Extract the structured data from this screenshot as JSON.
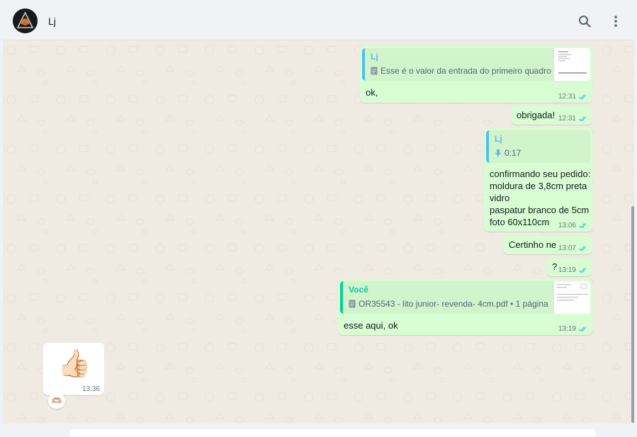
{
  "header": {
    "contact_name": "Lj",
    "search_icon": "search-icon",
    "menu_icon": "kebab-menu-icon"
  },
  "messages": [
    {
      "direction": "out",
      "quote": {
        "author": "Lj",
        "text": "Esse é o valor da entrada do primeiro quadro",
        "icon": "document-icon",
        "thumb": "document-thumbnail"
      },
      "text": "ok,",
      "time": "12:31",
      "status": "read"
    },
    {
      "direction": "out",
      "text": "obrigada!",
      "time": "12:31",
      "status": "read"
    },
    {
      "direction": "out",
      "quote": {
        "author": "Lj",
        "text": "0:17",
        "icon": "microphone-icon"
      },
      "text": "confirmando seu pedido:\nmoldura de 3,8cm preta\nvidro\npaspatur branco de 5cm\nfoto 60x110cm",
      "time": "13:06",
      "status": "read"
    },
    {
      "direction": "out",
      "text": "Certinho ne",
      "time": "13:07",
      "status": "read"
    },
    {
      "direction": "out",
      "text": "?",
      "time": "13:19",
      "status": "read"
    },
    {
      "direction": "out",
      "quote": {
        "author": "Você",
        "text": "OR35543 - lito junior- revenda- 4cm.pdf • 1 página",
        "icon": "document-icon",
        "thumb": "document-thumbnail"
      },
      "text": "esse aqui, ok",
      "time": "13:19",
      "status": "read"
    },
    {
      "direction": "in",
      "emoji": "👍🏻",
      "time": "13:36",
      "reaction": "🫶🏼"
    }
  ],
  "colors": {
    "outgoing_bubble": "#d9fdd3",
    "incoming_bubble": "#ffffff",
    "chat_background": "#efeae2",
    "read_ticks": "#53bdeb",
    "quote_blue": "#53bdeb",
    "quote_green": "#06cf9c"
  }
}
